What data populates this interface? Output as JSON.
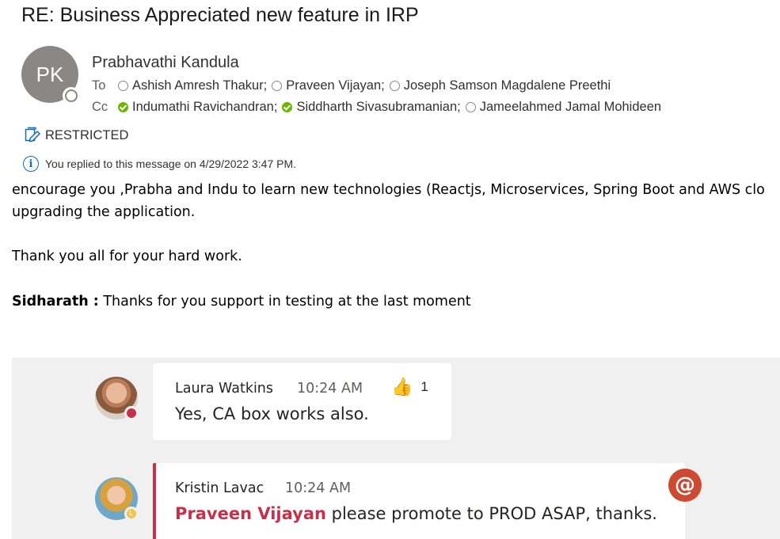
{
  "email": {
    "subject": "RE: Business Appreciated new feature in IRP",
    "sender": {
      "initials": "PK",
      "name": "Prabhavathi Kandula"
    },
    "to_label": "To",
    "cc_label": "Cc",
    "to": [
      {
        "name": "Ashish Amresh Thakur;",
        "presence": "offline"
      },
      {
        "name": "Praveen Vijayan;",
        "presence": "offline"
      },
      {
        "name": "Joseph Samson Magdalene Preethi",
        "presence": "offline"
      }
    ],
    "cc": [
      {
        "name": "Indumathi Ravichandran;",
        "presence": "available"
      },
      {
        "name": "Siddharth Sivasubramanian;",
        "presence": "available"
      },
      {
        "name": "Jameelahmed Jamal Mohideen",
        "presence": "offline"
      }
    ],
    "sensitivity": "RESTRICTED",
    "reply_info": "You replied to this message on 4/29/2022 3:47 PM."
  },
  "body": {
    "line1": "encourage you ,Prabha and Indu to learn new technologies (Reactjs, Microservices, Spring Boot and AWS clo",
    "line2": "upgrading the application.",
    "line3": "Thank you all for your hard work.",
    "line4_bold": "Sidharath :",
    "line4_rest": " Thanks for you support in testing at the last moment"
  },
  "chat": {
    "messages": [
      {
        "author": "Laura Watkins",
        "time": "10:24 AM",
        "text": "Yes, CA box works also.",
        "reaction_icon": "thumbs-up-icon",
        "reaction_count": "1",
        "status": "busy"
      },
      {
        "author": "Kristin Lavac",
        "time": "10:24 AM",
        "mention": "Praveen Vijayan",
        "text": " please promote to PROD ASAP, thanks.",
        "status": "away",
        "badge": "@"
      }
    ]
  },
  "colors": {
    "accent_blue": "#0f6cbd",
    "mention_red": "#c4314b",
    "available_green": "#6bb700",
    "away_yellow": "#f8c34c",
    "chat_bg": "#f0f0f0"
  }
}
